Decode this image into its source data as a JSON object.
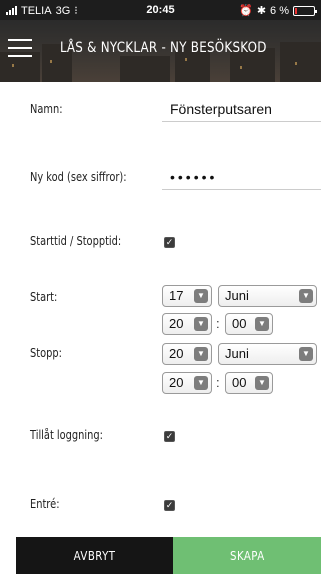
{
  "status_bar": {
    "carrier": "TELIA",
    "network": "3G",
    "time": "20:45",
    "battery_percent": "6 %",
    "battery_level": 0.06
  },
  "header": {
    "title": "LÅS & NYCKLAR - NY BESÖKSKOD",
    "menu_icon": "hamburger-menu-icon"
  },
  "form": {
    "name_label": "Namn:",
    "name_value": "Fönsterputsaren",
    "code_label": "Ny kod (sex siffror):",
    "code_value": "••••••",
    "time_toggle_label": "Starttid / Stopptid:",
    "time_toggle_checked": true,
    "start_label": "Start:",
    "start_day": "17",
    "start_month": "Juni",
    "start_hour": "20",
    "start_minute": "00",
    "stop_label": "Stopp:",
    "stop_day": "20",
    "stop_month": "Juni",
    "stop_hour": "20",
    "stop_minute": "00",
    "time_separator": ":",
    "logging_label": "Tillåt loggning:",
    "logging_checked": true,
    "entry_label": "Entré:",
    "entry_checked": true
  },
  "actions": {
    "cancel_label": "AVBRYT",
    "create_label": "SKAPA"
  },
  "colors": {
    "create_button": "#6fbf73",
    "cancel_button": "#151515"
  }
}
